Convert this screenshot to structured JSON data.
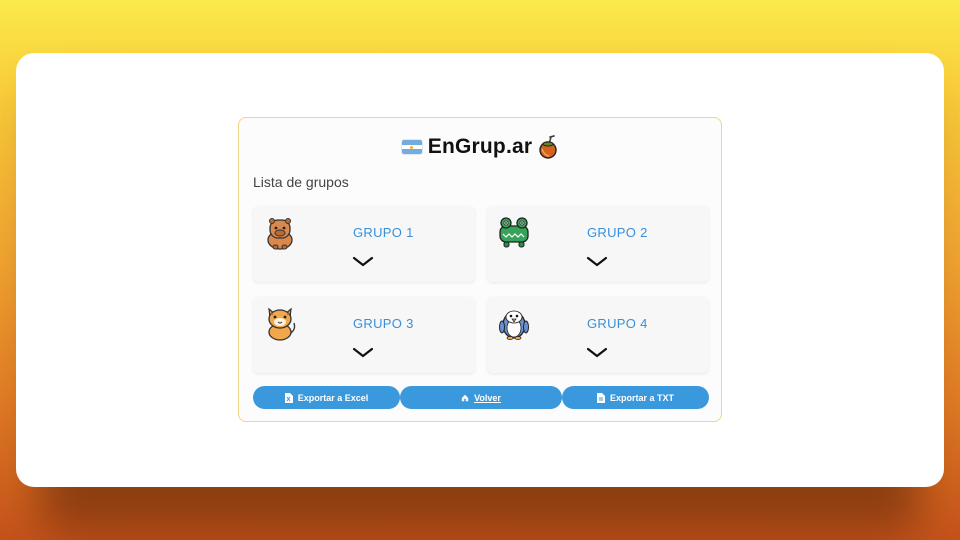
{
  "app": {
    "title": "EnGrup.ar",
    "flag_icon": "argentina-flag-icon",
    "logo_icon": "mate-gourd-icon"
  },
  "section_label": "Lista de grupos",
  "groups": [
    {
      "name": "GRUPO 1",
      "avatar_icon": "capybara-icon",
      "expand_icon": "chevron-down-icon"
    },
    {
      "name": "GRUPO 2",
      "avatar_icon": "crocodile-icon",
      "expand_icon": "chevron-down-icon"
    },
    {
      "name": "GRUPO 3",
      "avatar_icon": "cat-icon",
      "expand_icon": "chevron-down-icon"
    },
    {
      "name": "GRUPO 4",
      "avatar_icon": "penguin-icon",
      "expand_icon": "chevron-down-icon"
    }
  ],
  "actions": {
    "export_excel": {
      "label": "Exportar a Excel",
      "icon": "excel-file-icon"
    },
    "back": {
      "label": "Volver",
      "icon": "home-icon"
    },
    "export_txt": {
      "label": "Exportar a TXT",
      "icon": "text-file-icon"
    }
  },
  "colors": {
    "accent": "#3a98dd",
    "group_name": "#3a8fd8",
    "card_border": "#f4d38a"
  }
}
